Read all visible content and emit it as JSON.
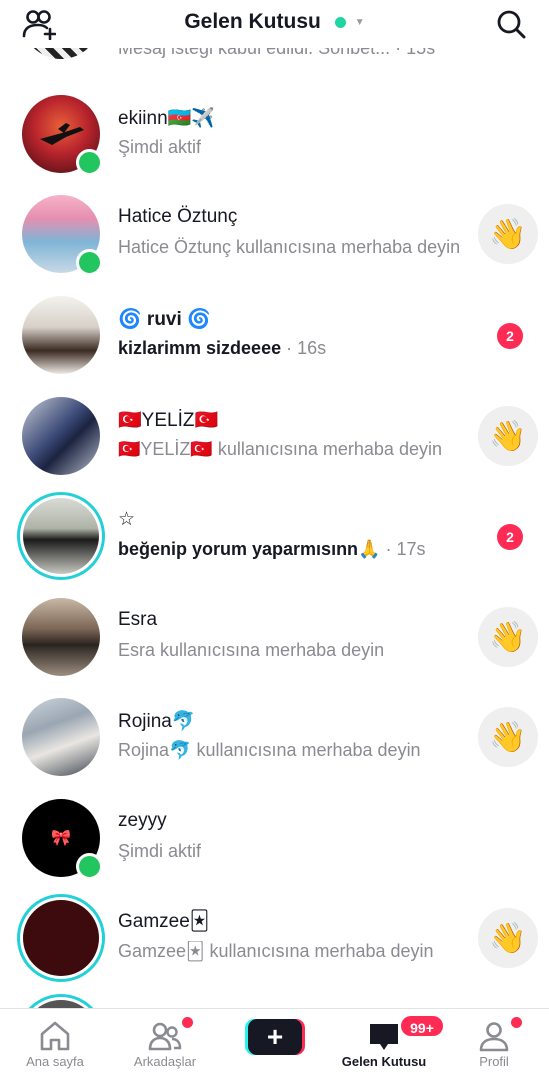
{
  "header": {
    "title": "Gelen Kutusu"
  },
  "top_partial_text": "Mesaj isteği kabul edildi. Sohbet... · 15s",
  "conversations": [
    {
      "name": "ekiinn🇦🇿✈️",
      "sub": "Şimdi aktif",
      "name_bold": false,
      "sub_bold": false,
      "time": ""
    },
    {
      "name": "Hatice Öztunç",
      "sub": "Hatice Öztunç kullanıcısına merhaba deyin",
      "name_bold": false,
      "sub_bold": false,
      "time": ""
    },
    {
      "name": "🌀 ruvi 🌀",
      "sub": "kizlarimm sizdeeee",
      "name_bold": true,
      "sub_bold": true,
      "time": " · 16s",
      "badge": "2"
    },
    {
      "name": "🇹🇷YELİZ🇹🇷",
      "sub": "🇹🇷YELİZ🇹🇷 kullanıcısına merhaba deyin",
      "name_bold": false,
      "sub_bold": false,
      "time": ""
    },
    {
      "name": "☆",
      "sub": "beğenip yorum yaparmısınn🙏",
      "name_bold": false,
      "sub_bold": true,
      "time": " · 17s",
      "badge": "2"
    },
    {
      "name": "Esra",
      "sub": "Esra kullanıcısına merhaba deyin",
      "name_bold": false,
      "sub_bold": false,
      "time": ""
    },
    {
      "name": "Rojina🐬",
      "sub": "Rojina🐬 kullanıcısına merhaba deyin",
      "name_bold": false,
      "sub_bold": false,
      "time": ""
    },
    {
      "name": "zeyyy",
      "sub": "Şimdi aktif",
      "name_bold": false,
      "sub_bold": false,
      "time": ""
    },
    {
      "name": "Gamzee🃏",
      "sub": "Gamzee🃏 kullanıcısına merhaba deyin",
      "name_bold": false,
      "sub_bold": false,
      "time": ""
    }
  ],
  "wave_emoji": "👋",
  "avatar_glyphs": {
    "zeyyy": "🎀"
  },
  "navbar": {
    "home": "Ana sayfa",
    "friends": "Arkadaşlar",
    "create": "+",
    "inbox": "Gelen Kutusu",
    "inbox_badge": "99+",
    "profile": "Profil"
  },
  "colors": {
    "accent": "#fe2c55",
    "story_ring": "#22d0d8",
    "online": "#22c55e",
    "status_dot": "#20d5a2"
  }
}
